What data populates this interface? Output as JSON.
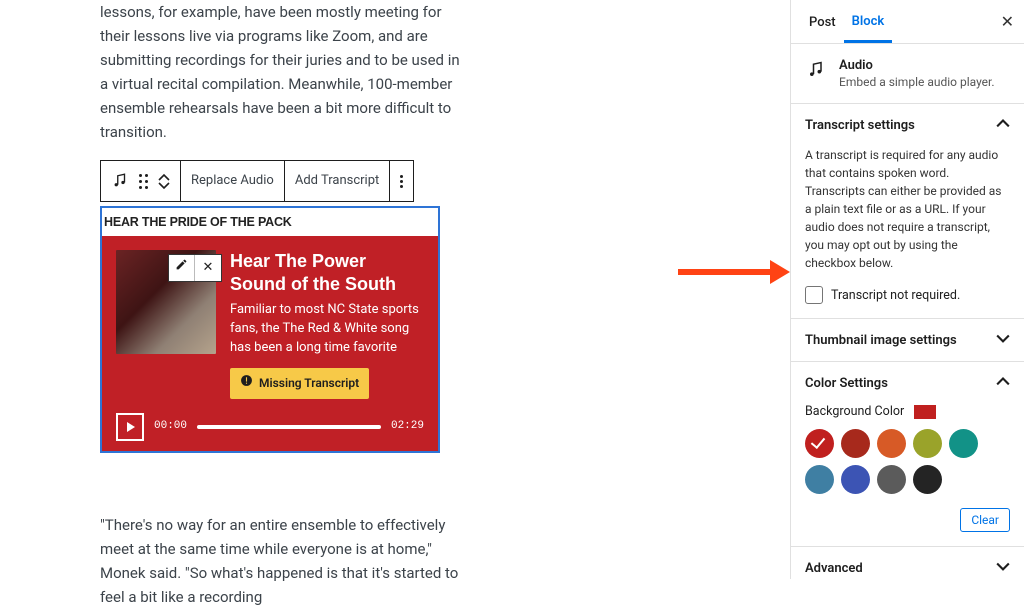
{
  "content": {
    "para_top": "lessons, for example, have been mostly meeting for their lessons live via programs like Zoom, and are submitting recordings for their juries and to be used in a virtual recital compilation. Meanwhile, 100-member ensemble rehearsals have been a bit more difficult to transition.",
    "para_bottom": "\"There's no way for an entire ensemble to effectively meet at the same time while everyone is at home,\" Monek said. \"So what's happened is that it's started to feel a bit like a recording"
  },
  "toolbar": {
    "replace_label": "Replace Audio",
    "add_transcript_label": "Add Transcript"
  },
  "audio_block": {
    "mini_title": "HEAR THE PRIDE OF THE PACK",
    "title": "Hear The Power Sound of the South",
    "description": "Familiar to most NC State sports fans, the The Red & White song has been a long time favorite",
    "missing_label": "Missing Transcript",
    "time_start": "00:00",
    "time_end": "02:29"
  },
  "sidebar": {
    "tabs": {
      "post": "Post",
      "block": "Block"
    },
    "block_id": {
      "title": "Audio",
      "desc": "Embed a simple audio player."
    },
    "transcript_panel": {
      "title": "Transcript settings",
      "help": "A transcript is required for any audio that contains spoken word. Transcripts can either be provided as a plain text file or as a URL. If your audio does not require a transcript, you may opt out by using the checkbox below.",
      "chk_label": "Transcript not required."
    },
    "thumbnail_panel": {
      "title": "Thumbnail image settings"
    },
    "color_panel": {
      "title": "Color Settings",
      "bg_label": "Background Color",
      "clear": "Clear"
    },
    "advanced_panel": {
      "title": "Advanced"
    },
    "colors": {
      "selected": "#c0201f",
      "swatches": [
        "#c0201f",
        "#a7291c",
        "#d75a26",
        "#9aa32a",
        "#129287",
        "#3f7fa3",
        "#3c54b4",
        "#5b5b5b",
        "#242424"
      ]
    }
  }
}
